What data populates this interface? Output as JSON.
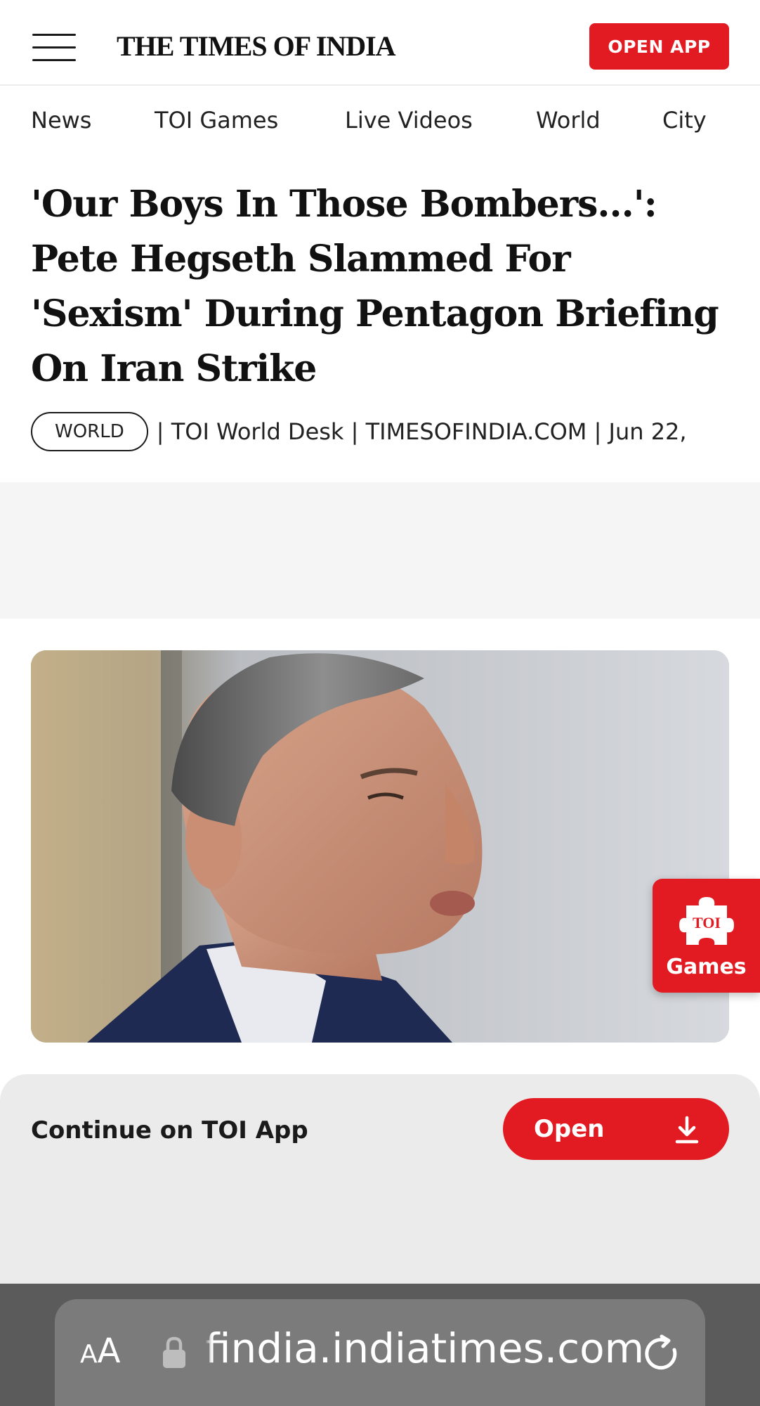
{
  "header": {
    "logo": "THE TIMES OF INDIA",
    "open_app_label": "OPEN APP"
  },
  "nav": {
    "items": [
      {
        "label": "News"
      },
      {
        "label": "TOI Games"
      },
      {
        "label": "Live Videos"
      },
      {
        "label": "World"
      },
      {
        "label": "City"
      }
    ]
  },
  "article": {
    "headline_lines": [
      "'Our Boys In Those Bombers...':",
      "Pete Hegseth Slammed For",
      "'Sexism' During Pentagon Briefing",
      "On Iran Strike"
    ],
    "category_tag": "WORLD",
    "byline": "| TOI World Desk | TIMESOFINDIA.COM | Jun 22,"
  },
  "games_fab": {
    "badge_text": "TOI",
    "label": "Games"
  },
  "app_banner": {
    "text": "Continue on TOI App",
    "open_label": "Open"
  },
  "browser": {
    "aa_large": "A",
    "aa_small": "A",
    "url": "findia.indiatimes.com"
  },
  "colors": {
    "brand_red": "#e21b22",
    "banner_bg": "#ebebeb",
    "browser_bar": "#5b5b5b"
  },
  "icons": [
    "menu-icon",
    "download-icon",
    "lock-icon",
    "reload-icon",
    "puzzle-icon"
  ]
}
